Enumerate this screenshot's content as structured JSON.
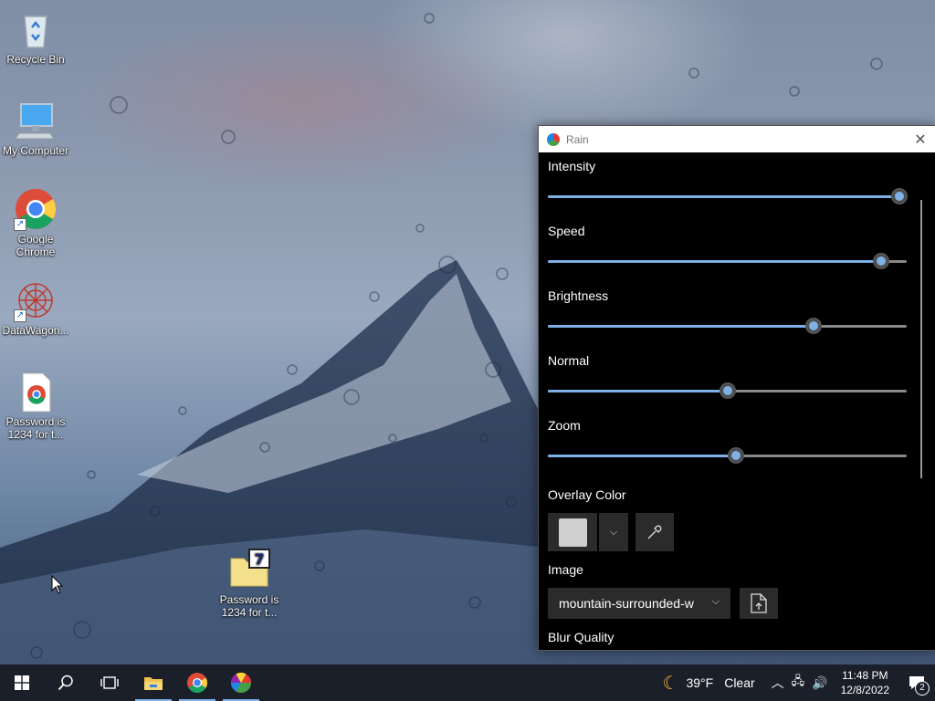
{
  "desktop": {
    "icons": [
      {
        "label": "Recycle Bin",
        "icon": "recycle-bin-icon"
      },
      {
        "label": "My Computer",
        "icon": "computer-icon"
      },
      {
        "label": "Google Chrome",
        "icon": "chrome-icon"
      },
      {
        "label": "DataWagon...",
        "icon": "datawagon-icon"
      },
      {
        "label": "Password is 1234 for t...",
        "icon": "chrome-html-file-icon"
      },
      {
        "label": "Password is 1234 for t...",
        "icon": "7zip-archive-icon"
      }
    ]
  },
  "rain_window": {
    "title": "Rain",
    "sliders": [
      {
        "label": "Intensity",
        "value": 0.98
      },
      {
        "label": "Speed",
        "value": 0.93
      },
      {
        "label": "Brightness",
        "value": 0.74
      },
      {
        "label": "Normal",
        "value": 0.5
      },
      {
        "label": "Zoom",
        "value": 0.525
      }
    ],
    "overlay_color_label": "Overlay Color",
    "overlay_color": "#cfcfcf",
    "image_label": "Image",
    "image_value": "mountain-surrounded-w",
    "blur_quality_label": "Blur Quality"
  },
  "taskbar": {
    "apps": [
      "start-icon",
      "search-icon",
      "task-view-icon",
      "file-explorer-icon",
      "chrome-icon",
      "rain-app-icon"
    ],
    "weather_temp": "39°F",
    "weather_desc": "Clear",
    "time": "11:48 PM",
    "date": "12/8/2022",
    "notification_count": "2"
  },
  "colors": {
    "accent": "#7fb0e6",
    "taskbar": "#1a1f29",
    "window_bg": "#000000"
  }
}
